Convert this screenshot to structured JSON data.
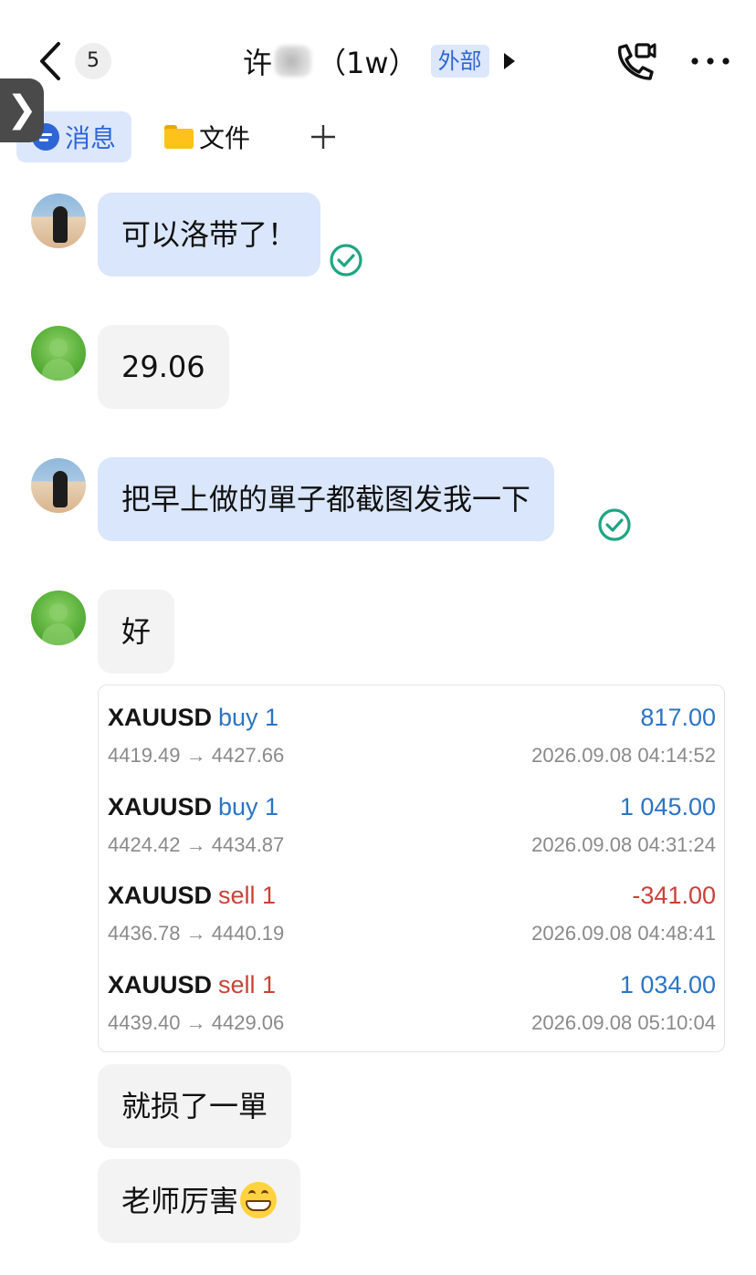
{
  "header": {
    "unread_count": "5",
    "title_prefix": "许",
    "title_suffix": "（1w）",
    "external_badge": "外部"
  },
  "side_handle": {
    "glyph": "❯"
  },
  "tabs": [
    {
      "label": "消息",
      "active": true
    },
    {
      "label": "文件",
      "active": false
    }
  ],
  "messages": [
    {
      "sender": "me",
      "text": "可以洛带了！",
      "read": true
    },
    {
      "sender": "contact",
      "text": "29.06"
    },
    {
      "sender": "me",
      "text": "把早上做的單子都截图发我一下",
      "read": true
    },
    {
      "sender": "contact",
      "text": "好"
    },
    {
      "sender": "contact",
      "text": "就损了一單"
    },
    {
      "sender": "contact",
      "text": "老师厉害",
      "emoji": "grinning-face"
    }
  ],
  "trades": [
    {
      "symbol": "XAUUSD",
      "direction": "buy 1",
      "profit": "817.00",
      "prices": "4419.49 → 4427.66",
      "time": "2026.09.08 04:14:52"
    },
    {
      "symbol": "XAUUSD",
      "direction": "buy 1",
      "profit": "1 045.00",
      "prices": "4424.42 → 4434.87",
      "time": "2026.09.08 04:31:24"
    },
    {
      "symbol": "XAUUSD",
      "direction": "sell 1",
      "profit": "-341.00",
      "prices": "4436.78 → 4440.19",
      "time": "2026.09.08 04:48:41"
    },
    {
      "symbol": "XAUUSD",
      "direction": "sell 1",
      "profit": "1 034.00",
      "prices": "4439.40 → 4429.06",
      "time": "2026.09.08 05:10:04"
    }
  ],
  "colors": {
    "accent_blue": "#2f66d6",
    "my_bubble": "#d9e6fb",
    "their_bubble": "#f3f3f3",
    "read_check": "#1fa583",
    "buy": "#2b74c5",
    "sell": "#c84238"
  },
  "icons": {
    "back": "chevron-left-icon",
    "call": "phone-video-icon",
    "more": "more-horizontal-icon",
    "add_tab": "plus-icon",
    "read": "check-circle-icon"
  }
}
